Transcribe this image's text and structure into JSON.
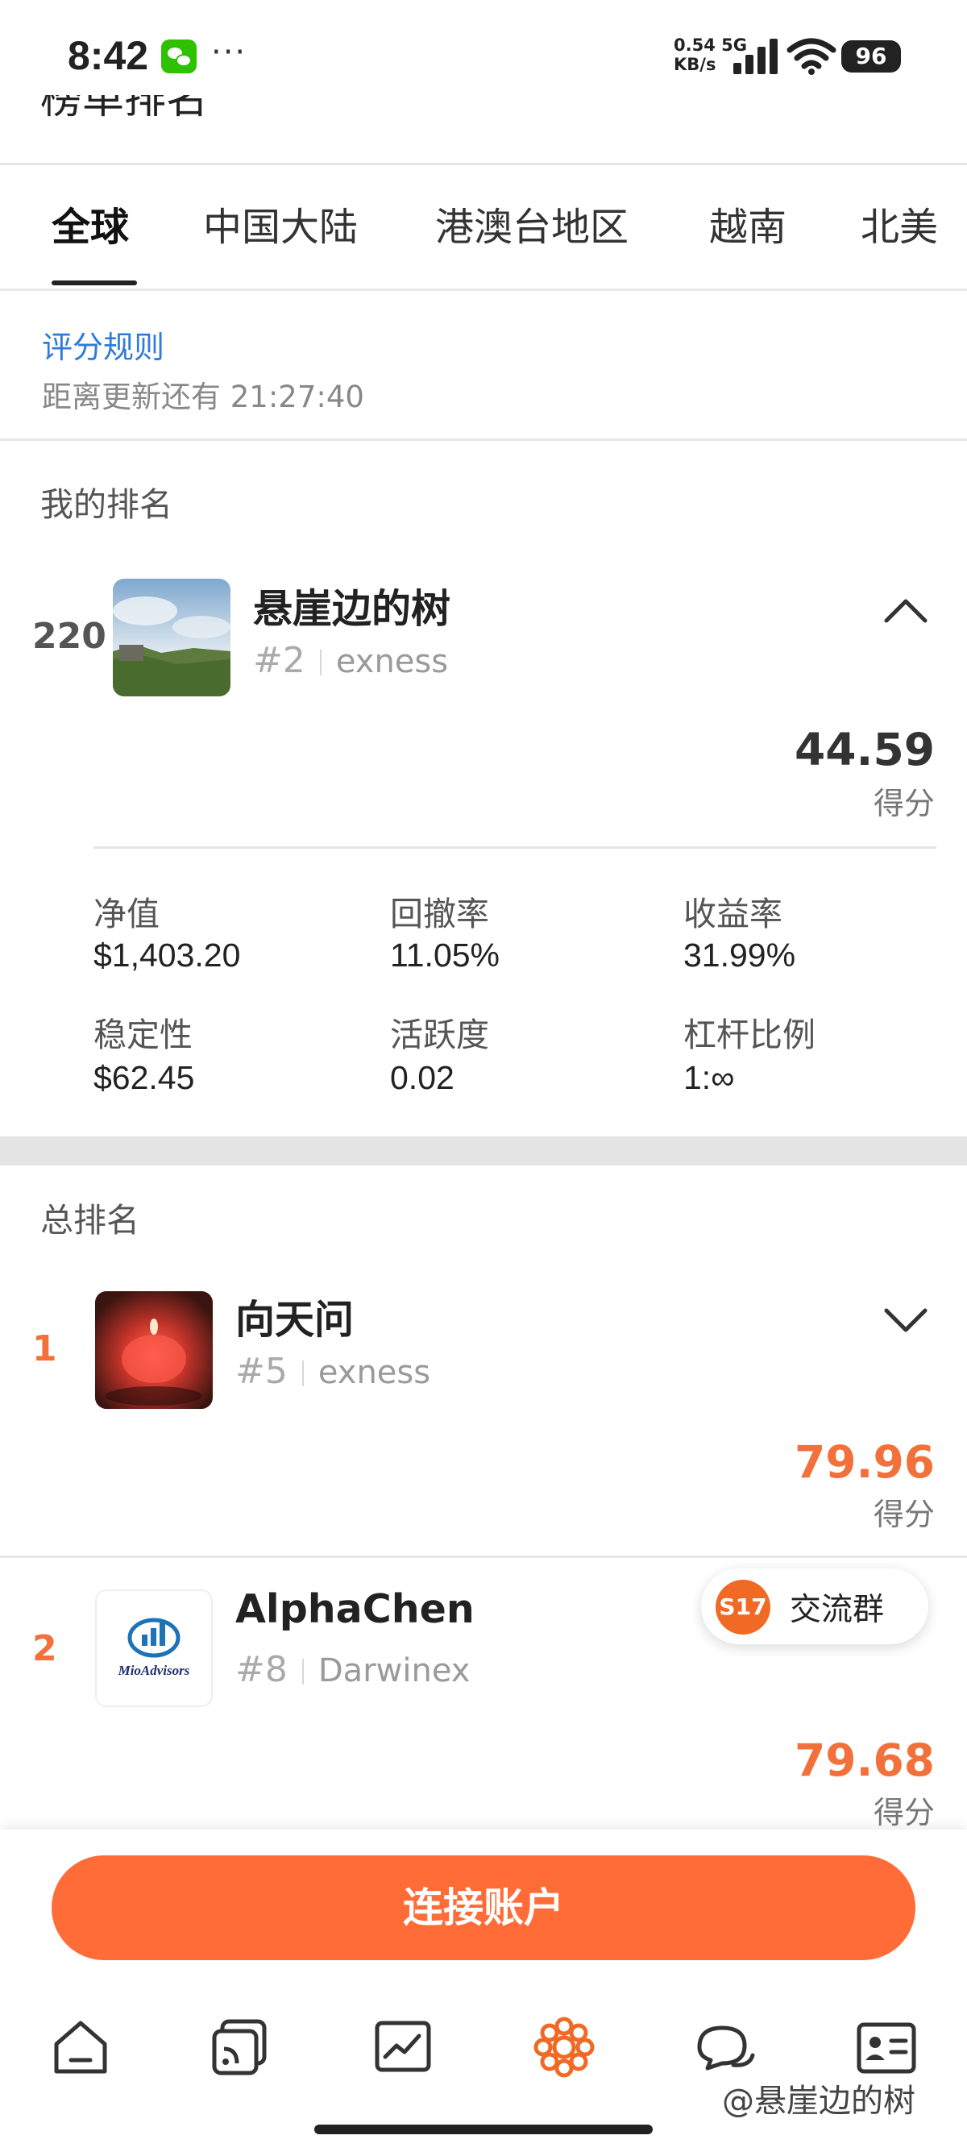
{
  "status_bar": {
    "time": "8:42",
    "net_speed_value": "0.54",
    "net_speed_unit": "KB/s",
    "network": "5G",
    "battery": "96",
    "icons": [
      "wechat-icon",
      "more-dots-icon",
      "signal-icon",
      "wifi-icon",
      "battery-icon"
    ]
  },
  "page": {
    "title_partial": "榜单排名"
  },
  "tabs": [
    {
      "label": "全球",
      "active": true
    },
    {
      "label": "中国大陆",
      "active": false
    },
    {
      "label": "港澳台地区",
      "active": false
    },
    {
      "label": "越南",
      "active": false
    },
    {
      "label": "北美",
      "active": false
    }
  ],
  "rules": {
    "link_label": "评分规则",
    "countdown": "距离更新还有 21:27:40"
  },
  "my_ranking": {
    "section_label": "我的排名",
    "rank": "220",
    "name": "悬崖边的树",
    "hash_rank": "#2",
    "broker": "exness",
    "score": "44.59",
    "score_label": "得分",
    "stats": [
      {
        "label": "净值",
        "value": "$1,403.20"
      },
      {
        "label": "回撤率",
        "value": "11.05%"
      },
      {
        "label": "收益率",
        "value": "31.99%"
      },
      {
        "label": "稳定性",
        "value": "$62.45"
      },
      {
        "label": "活跃度",
        "value": "0.02"
      },
      {
        "label": "杠杆比例",
        "value": "1:∞"
      }
    ]
  },
  "overall_ranking": {
    "section_label": "总排名",
    "rows": [
      {
        "rank": "1",
        "name": "向天问",
        "hash_rank": "#5",
        "broker": "exness",
        "score": "79.96",
        "score_label": "得分"
      },
      {
        "rank": "2",
        "name": "AlphaChen",
        "hash_rank": "#8",
        "broker": "Darwinex",
        "score": "79.68",
        "score_label": "得分",
        "avatar_text": "MioAdvisors"
      }
    ]
  },
  "floating_group": {
    "badge": "S17",
    "label": "交流群"
  },
  "connect_button": {
    "label": "连接账户"
  },
  "bottom_nav": [
    "home-icon",
    "feed-icon",
    "chart-icon",
    "ranking-icon",
    "chat-icon",
    "profile-icon"
  ],
  "watermark": "@悬崖边的树",
  "colors": {
    "accent": "#ff6c37",
    "rank_orange": "#f2703a",
    "link_blue": "#2f7bd9"
  }
}
